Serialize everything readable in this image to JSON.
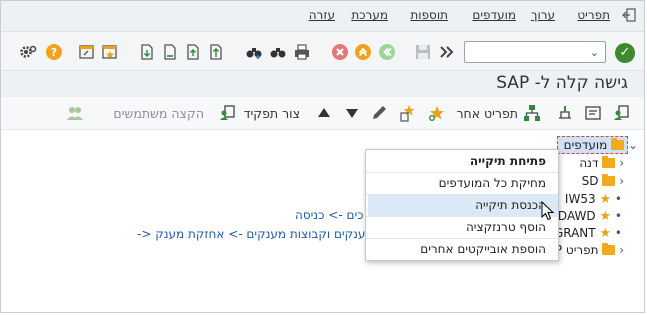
{
  "menu": {
    "items": [
      "תפריט",
      "ערוך",
      "מועדפים",
      "תוספות",
      "מערכת",
      "עזרה"
    ]
  },
  "toolbar": {
    "command_placeholder": ""
  },
  "title": "גישה קלה ל- SAP",
  "app_toolbar": {
    "other_menu_label": "תפריט אחר",
    "create_role_label": "צור תפקיד",
    "assign_users_label": "הקצה משתמשים"
  },
  "tree": {
    "root_label": "מועדפים",
    "children": [
      {
        "label": "דנה",
        "type": "folder"
      },
      {
        "label": "SD",
        "type": "folder"
      },
      {
        "label": "IW53",
        "type": "star"
      },
      {
        "label": "DAWD",
        "type": "star"
      },
      {
        "label": "GRANT",
        "type": "star"
      },
      {
        "label": "תפריט P",
        "type": "folder"
      }
    ]
  },
  "paths": {
    "line1": "כים -> כניסה",
    "line2": "מענקים וקבוצות מענקים -> אחזקת מענק <-"
  },
  "context_menu": {
    "header": "פתיחת תיקייה",
    "items": [
      "מחיקת כל המועדפים",
      "הכנסת תיקייה",
      "הוסף טרנזקציה",
      "הוספת אובייקטים אחרים"
    ]
  },
  "colors": {
    "ok_green": "#3d8b2f",
    "folder_orange": "#f2a91c",
    "star_yellow": "#e9a317",
    "link_blue": "#1f5aa6"
  }
}
